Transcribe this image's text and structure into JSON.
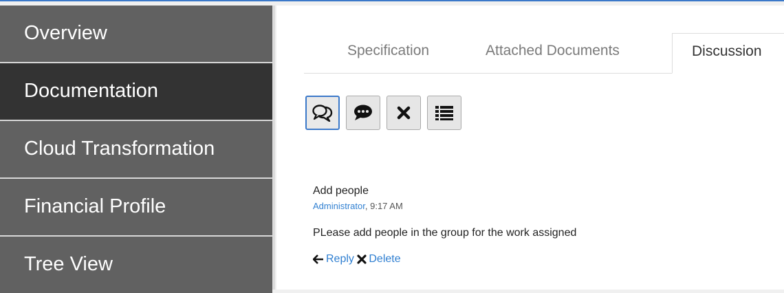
{
  "sidebar": {
    "items": [
      {
        "label": "Overview"
      },
      {
        "label": "Documentation",
        "active": true
      },
      {
        "label": "Cloud Transformation"
      },
      {
        "label": "Financial Profile"
      },
      {
        "label": "Tree View"
      }
    ]
  },
  "tabs": [
    {
      "label": "Specification"
    },
    {
      "label": "Attached Documents"
    },
    {
      "label": "Discussion",
      "active": true
    }
  ],
  "toolbar": {
    "buttons": [
      {
        "icon": "comments-icon",
        "selected": true
      },
      {
        "icon": "comment-bubble-icon"
      },
      {
        "icon": "close-icon"
      },
      {
        "icon": "list-icon"
      }
    ]
  },
  "discussion": {
    "title": "Add people",
    "author": "Administrator",
    "time": ", 9:17 AM",
    "body": "PLease add people in the group for the work assigned",
    "reply_label": "Reply",
    "delete_label": "Delete"
  },
  "colors": {
    "sidebar_bg": "#616161",
    "sidebar_active": "#333333",
    "link": "#2f7fd1",
    "accent": "#3a78c9"
  }
}
